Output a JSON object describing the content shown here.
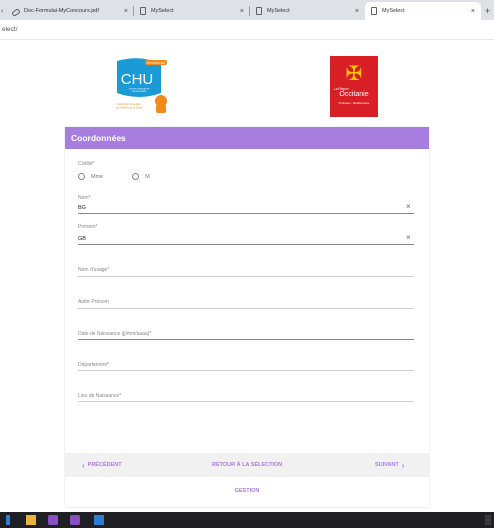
{
  "browser": {
    "tabs": [
      {
        "title": "Doc-Formulai-MyConcours.pdf",
        "active": false
      },
      {
        "title": "MySelect",
        "active": false
      },
      {
        "title": "MySelect",
        "active": false
      },
      {
        "title": "MySelect",
        "active": true
      }
    ],
    "close_glyph": "×",
    "new_tab_glyph": "+",
    "overflow_glyph": "‹",
    "address": "elect/"
  },
  "logos": {
    "chu": {
      "text": "CHU",
      "tag": "MONTPELLIER",
      "small_left": "Institut de Formation\naux Métiers de la Santé",
      "small_top": "CENTRE HOSPITALIER\nUNIVERSITAIRE"
    },
    "region": {
      "top": "La Région",
      "name": "Occitanie",
      "sub": "Pyrénées - Méditerranée",
      "cross": "✠"
    }
  },
  "form": {
    "title": "Coordonnées",
    "civilite": {
      "label": "Civilité*",
      "options": [
        "Mme",
        "M"
      ]
    },
    "nom": {
      "label": "Nom*",
      "value": "BG"
    },
    "prenom": {
      "label": "Prénom*",
      "value": "GB"
    },
    "nom_usage": {
      "label": "Nom d'usage*"
    },
    "autre_prenom": {
      "label": "Autre Prénom"
    },
    "date_naissance": {
      "label": "Date de Naissance (jj/mm/aaaa)*"
    },
    "departement": {
      "label": "Département*"
    },
    "lieu_naissance": {
      "label": "Lieu de Naissance*"
    },
    "clear_glyph": "×"
  },
  "footer": {
    "previous": "PRÉCÉDENT",
    "back": "RETOUR À LA SÉLECTION",
    "next": "SUIVANT",
    "prev_chevron": "‹",
    "next_chevron": "›",
    "gestion": "GESTION"
  },
  "colors": {
    "accent": "#a77de0",
    "region_red": "#d81f26",
    "chu_blue": "#1a9bd6",
    "chu_orange": "#f08a1c",
    "taskbar": "#1f1f24"
  },
  "taskbar": {
    "icons": [
      "start-icon",
      "file-explorer-icon",
      "app-icon",
      "app-icon-2",
      "app-icon-3"
    ]
  }
}
